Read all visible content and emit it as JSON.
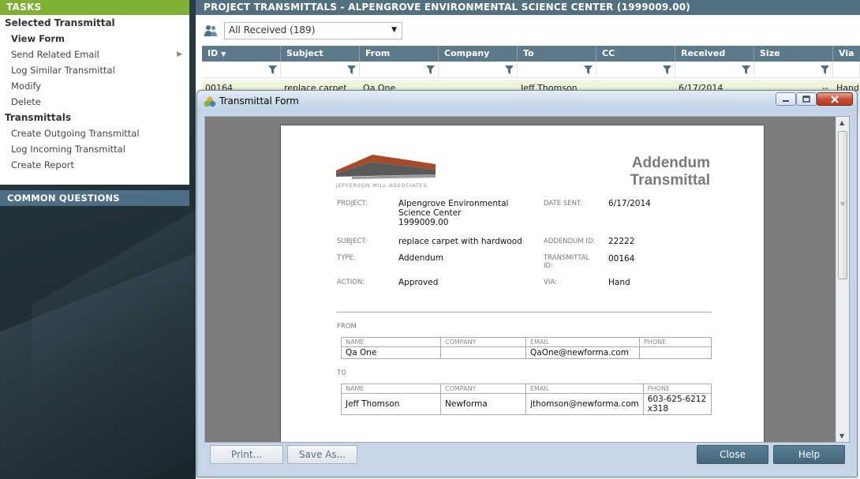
{
  "sidebar": {
    "tasks_header": "TASKS",
    "sections": [
      {
        "title": "Selected Transmittal",
        "items": [
          {
            "label": "View Form",
            "bold": true
          },
          {
            "label": "Send Related Email",
            "submenu": true
          },
          {
            "label": "Log Similar Transmittal"
          },
          {
            "label": "Modify"
          },
          {
            "label": "Delete"
          }
        ]
      },
      {
        "title": "Transmittals",
        "items": [
          {
            "label": "Create Outgoing Transmittal"
          },
          {
            "label": "Log Incoming Transmittal"
          },
          {
            "label": "Create Report"
          }
        ]
      }
    ],
    "common_questions": "COMMON QUESTIONS"
  },
  "main": {
    "title": "PROJECT TRANSMITTALS - ALPENGROVE ENVIRONMENTAL SCIENCE CENTER (1999009.00)",
    "view_filter": "All Received (189)",
    "columns": [
      "ID",
      "Subject",
      "From",
      "Company",
      "To",
      "CC",
      "Received",
      "Size",
      "Via"
    ],
    "rows": [
      {
        "id": "00164",
        "subject": "replace carpet",
        "from": "Qa One",
        "company": "",
        "to": "Jeff Thomson",
        "cc": "",
        "received": "6/17/2014",
        "size": "--",
        "via": "Hand"
      }
    ]
  },
  "modal": {
    "title": "Transmittal Form",
    "document": {
      "logo_text": "JEFFERSON MILL ASSOCIATES",
      "title_line1": "Addendum",
      "title_line2": "Transmittal",
      "fields": {
        "project_label": "PROJECT:",
        "project_value_line1": "Alpengrove Environmental",
        "project_value_line2": "Science Center",
        "project_value_line3": "1999009.00",
        "date_sent_label": "DATE SENT:",
        "date_sent_value": "6/17/2014",
        "subject_label": "SUBJECT:",
        "subject_value": "replace carpet with hardwood",
        "addendum_id_label": "ADDENDUM ID:",
        "addendum_id_value": "22222",
        "type_label": "TYPE:",
        "type_value": "Addendum",
        "transmittal_id_label_line1": "TRANSMITTAL",
        "transmittal_id_label_line2": "ID:",
        "transmittal_id_value": "00164",
        "action_label": "ACTION:",
        "action_value": "Approved",
        "via_label": "VIA:",
        "via_value": "Hand"
      },
      "from_label": "FROM",
      "to_label": "TO",
      "contact_headers": {
        "name": "NAME",
        "company": "COMPANY",
        "email": "EMAIL",
        "phone": "PHONE"
      },
      "from_contact": {
        "name": "Qa One",
        "company": "",
        "email": "QaOne@newforma.com",
        "phone": ""
      },
      "to_contact": {
        "name": "Jeff Thomson",
        "company": "Newforma",
        "email": "jthomson@newforma.com",
        "phone_line1": "603-625-6212",
        "phone_line2": "x318"
      }
    },
    "buttons": {
      "print": "Print...",
      "save_as": "Save As...",
      "close": "Close",
      "help": "Help"
    }
  }
}
